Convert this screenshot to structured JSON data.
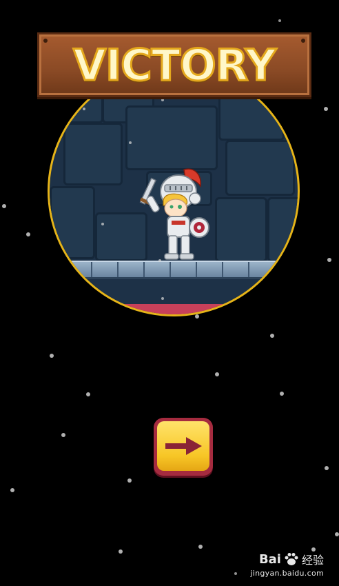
{
  "screen": {
    "title": "VICTORY",
    "scene_character": "knight",
    "next_button_icon": "arrow-right-icon"
  },
  "watermark": {
    "brand_prefix": "Bai",
    "brand_suffix": "经验",
    "url": "jingyan.baidu.com",
    "logo": "paw-icon"
  },
  "colors": {
    "background": "#000000",
    "sign_wood": "#8a4a25",
    "title_fill": "#fff7c9",
    "title_stroke": "#e4a81d",
    "scene_ring": "#e6b418",
    "button_yellow": "#f7c626",
    "button_border": "#a52b3f",
    "arrow": "#8a2336"
  }
}
